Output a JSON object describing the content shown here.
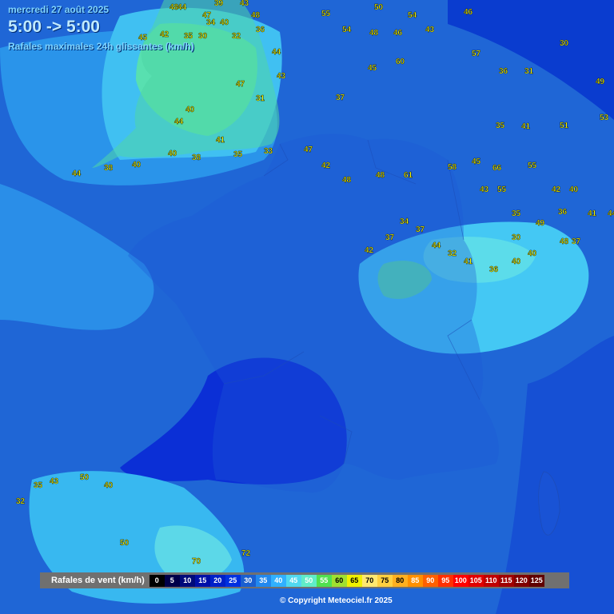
{
  "header": {
    "date": "mercredi 27 août 2025",
    "time_range": "5:00 -> 5:00",
    "subtitle": "Rafales maximales 24h glissantes (km/h)"
  },
  "legend": {
    "title": "Rafales de vent (km/h)",
    "items": [
      {
        "label": "0",
        "color": "#000000"
      },
      {
        "label": "5",
        "color": "#00004a"
      },
      {
        "label": "10",
        "color": "#000a7a"
      },
      {
        "label": "15",
        "color": "#0010a8"
      },
      {
        "label": "20",
        "color": "#0020c8"
      },
      {
        "label": "25",
        "color": "#0030e0"
      },
      {
        "label": "30",
        "color": "#1a5fd0"
      },
      {
        "label": "35",
        "color": "#2288ee"
      },
      {
        "label": "40",
        "color": "#30b0ff"
      },
      {
        "label": "45",
        "color": "#50d8f0"
      },
      {
        "label": "50",
        "color": "#60ecc8"
      },
      {
        "label": "55",
        "color": "#50e050"
      },
      {
        "label": "60",
        "color": "#a0e030"
      },
      {
        "label": "65",
        "color": "#f0f000"
      },
      {
        "label": "70",
        "color": "#ffe870"
      },
      {
        "label": "75",
        "color": "#ffd040"
      },
      {
        "label": "80",
        "color": "#ffb020"
      },
      {
        "label": "85",
        "color": "#ff9000"
      },
      {
        "label": "90",
        "color": "#ff6000"
      },
      {
        "label": "95",
        "color": "#ff3000"
      },
      {
        "label": "100",
        "color": "#ff0000"
      },
      {
        "label": "105",
        "color": "#e00000"
      },
      {
        "label": "110",
        "color": "#c00000"
      },
      {
        "label": "115",
        "color": "#a00000"
      },
      {
        "label": "120",
        "color": "#800000"
      },
      {
        "label": "125",
        "color": "#600000"
      }
    ]
  },
  "copyright": "© Copyright Meteociel.fr 2025",
  "stations": [
    "48",
    "44",
    "47",
    "39",
    "43",
    "48",
    "34",
    "40",
    "45",
    "42",
    "35",
    "30",
    "32",
    "36",
    "44",
    "43",
    "47",
    "31",
    "40",
    "44",
    "55",
    "54",
    "48",
    "46",
    "43",
    "46",
    "54",
    "50",
    "37",
    "45",
    "60",
    "57",
    "36",
    "31",
    "30",
    "49",
    "51",
    "53",
    "35",
    "41",
    "44",
    "38",
    "40",
    "40",
    "38",
    "41",
    "35",
    "33",
    "47",
    "42",
    "48",
    "48",
    "61",
    "58",
    "45",
    "66",
    "55",
    "43",
    "55",
    "42",
    "40",
    "41",
    "44",
    "36",
    "35",
    "49",
    "30",
    "48",
    "37",
    "40",
    "40",
    "36",
    "41",
    "32",
    "44",
    "37",
    "34",
    "37",
    "42",
    "70",
    "72",
    "50",
    "40",
    "50",
    "43",
    "35",
    "32"
  ]
}
